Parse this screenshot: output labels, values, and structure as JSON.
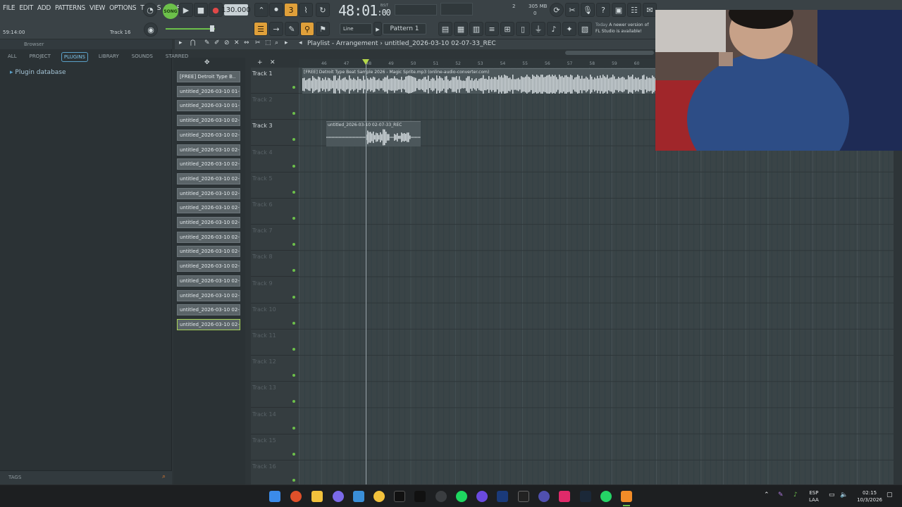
{
  "menu": [
    "FILE",
    "EDIT",
    "ADD",
    "PATTERNS",
    "VIEW",
    "OPTIONS",
    "TOOLS",
    "HELP"
  ],
  "transport": {
    "mode_label": "SONG",
    "tempo": "130.000",
    "time": "48:01",
    "time_sub": ":00",
    "time_unit": "B:S:T",
    "memory": "305 MB",
    "cpu_value": "2",
    "poly_value": "0"
  },
  "status": {
    "left_text": "59:14:00",
    "hint_text": "Track 16"
  },
  "snap": "Line",
  "pattern": "Pattern 1",
  "news": {
    "prefix": "Today",
    "line1": "A newer version of",
    "line2": "FL Studio is available!"
  },
  "browser": {
    "title": "Browser",
    "tabs": [
      "ALL",
      "PROJECT",
      "PLUGINS",
      "LIBRARY",
      "SOUNDS",
      "STARRED"
    ],
    "active_tab": "PLUGINS",
    "root": "Plugin database",
    "tags_label": "TAGS"
  },
  "picker": [
    "[FREE] Detroit Type B..",
    "untitled_2026-03-10 01-..",
    "untitled_2026-03-10 01-..",
    "untitled_2026-03-10 02-..",
    "untitled_2026-03-10 02-..",
    "untitled_2026-03-10 02-..",
    "untitled_2026-03-10 02-..",
    "untitled_2026-03-10 02-..",
    "untitled_2026-03-10 02-..",
    "untitled_2026-03-10 02-..",
    "untitled_2026-03-10 02-..",
    "untitled_2026-03-10 02-..",
    "untitled_2026-03-10 02-..",
    "untitled_2026-03-10 02-..",
    "untitled_2026-03-10 02-..",
    "untitled_2026-03-10 02-..",
    "untitled_2026-03-10 02-..",
    "untitled_2026-03-10 02-.."
  ],
  "playlist": {
    "title": "Playlist - Arrangement",
    "separator": "›",
    "current": "untitled_2026-03-10 02-07-33_REC",
    "ruler": [
      "46",
      "47",
      "48",
      "49",
      "50",
      "51",
      "52",
      "53",
      "54",
      "55",
      "56",
      "57",
      "58",
      "59",
      "60"
    ],
    "tracks": [
      "Track 1",
      "Track 2",
      "Track 3",
      "Track 4",
      "Track 5",
      "Track 6",
      "Track 7",
      "Track 8",
      "Track 9",
      "Track 10",
      "Track 11",
      "Track 12",
      "Track 13",
      "Track 14",
      "Track 15",
      "Track 16"
    ],
    "clip1": "[FREE] Detroit Type Beat Sample 2026 - Magic Sprite.mp3 (online-audio-converter.com)",
    "clip2": "untitled_2026-03-10 02-07-33_REC"
  },
  "taskbar": {
    "lang1": "ESP",
    "lang2": "LAA",
    "time": "02:15",
    "date": "10/3/2026"
  },
  "colors": {
    "accent_green": "#6cc04a",
    "selection": "#a7d35a",
    "active_tab": "#7dc4ea"
  }
}
